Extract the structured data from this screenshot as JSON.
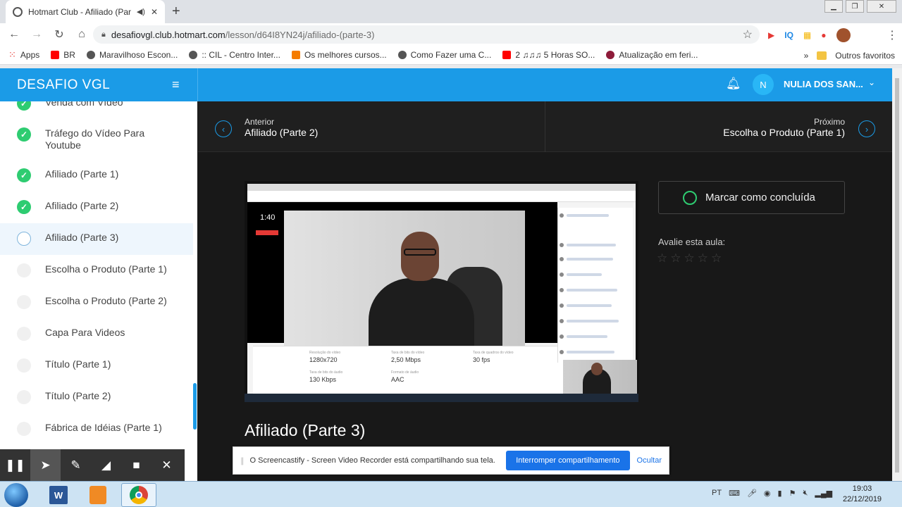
{
  "browser": {
    "tab_title": "Hotmart Club - Afiliado (Par",
    "new_tab": "+",
    "url_host": "desafiovgl.club.hotmart.com",
    "url_path": "/lesson/d64I8YN24j/afiliado-(parte-3)",
    "ext_iq": "IQ",
    "bookmarks": [
      {
        "label": "Apps",
        "color": "#e53935"
      },
      {
        "label": "BR",
        "color": "#ff0000"
      },
      {
        "label": "Maravilhoso Escon...",
        "color": "#333333"
      },
      {
        "label": ":: CIL - Centro Inter...",
        "color": "#333333"
      },
      {
        "label": "Os melhores cursos...",
        "color": "#f57c00"
      },
      {
        "label": "Como Fazer uma C...",
        "color": "#333333"
      },
      {
        "label": "2 ♫♫♫ 5 Horas SO...",
        "color": "#ff0000"
      },
      {
        "label": "Atualização em feri...",
        "color": "#8e1b3a"
      }
    ],
    "more_bookmarks": "»",
    "other_bookmarks": "Outros favoritos"
  },
  "app": {
    "brand": "DESAFIO VGL",
    "user_initial": "N",
    "user_name": "NULIA DOS SAN...",
    "accent_color": "#1b9be7"
  },
  "sidebar": {
    "lessons": [
      {
        "label": "Venda com Vídeo",
        "status": "done"
      },
      {
        "label": "Tráfego do Vídeo Para Youtube",
        "status": "done"
      },
      {
        "label": "Afiliado (Parte 1)",
        "status": "done"
      },
      {
        "label": "Afiliado (Parte 2)",
        "status": "done"
      },
      {
        "label": "Afiliado (Parte 3)",
        "status": "current"
      },
      {
        "label": "Escolha o Produto (Parte 1)",
        "status": "todo"
      },
      {
        "label": "Escolha o Produto (Parte 2)",
        "status": "todo"
      },
      {
        "label": "Capa Para Videos",
        "status": "todo"
      },
      {
        "label": "Título (Parte 1)",
        "status": "todo"
      },
      {
        "label": "Título (Parte 2)",
        "status": "todo"
      },
      {
        "label": "Fábrica de Idéias (Parte 1)",
        "status": "todo"
      }
    ]
  },
  "lesson_nav": {
    "prev_caption": "Anterior",
    "prev_title": "Afiliado (Parte 2)",
    "next_caption": "Próximo",
    "next_title": "Escolha o Produto (Parte 1)"
  },
  "video": {
    "timer": "1:40",
    "stats": [
      {
        "label": "Resolução do vídeo",
        "value": "1280x720"
      },
      {
        "label": "Taxa de bits do vídeo",
        "value": "2,50 Mbps"
      },
      {
        "label": "Taxa de quadros do vídeo",
        "value": "30 fps"
      },
      {
        "label": "Taxa de bits do áudio",
        "value": "130 Kbps"
      },
      {
        "label": "Formato de áudio",
        "value": "AAC"
      }
    ]
  },
  "lesson": {
    "title": "Afiliado (Parte 3)",
    "mark_complete": "Marcar como concluída",
    "rate_label": "Avalie esta aula:",
    "rating": 0,
    "stars": [
      "☆",
      "☆",
      "☆",
      "☆",
      "☆"
    ]
  },
  "screencastify": {
    "message": "O Screencastify - Screen Video Recorder está compartilhando sua tela.",
    "stop": "Interromper compartilhamento",
    "hide": "Ocultar"
  },
  "taskbar": {
    "lang": "PT",
    "word_letter": "W",
    "time": "19:03",
    "date": "22/12/2019"
  }
}
